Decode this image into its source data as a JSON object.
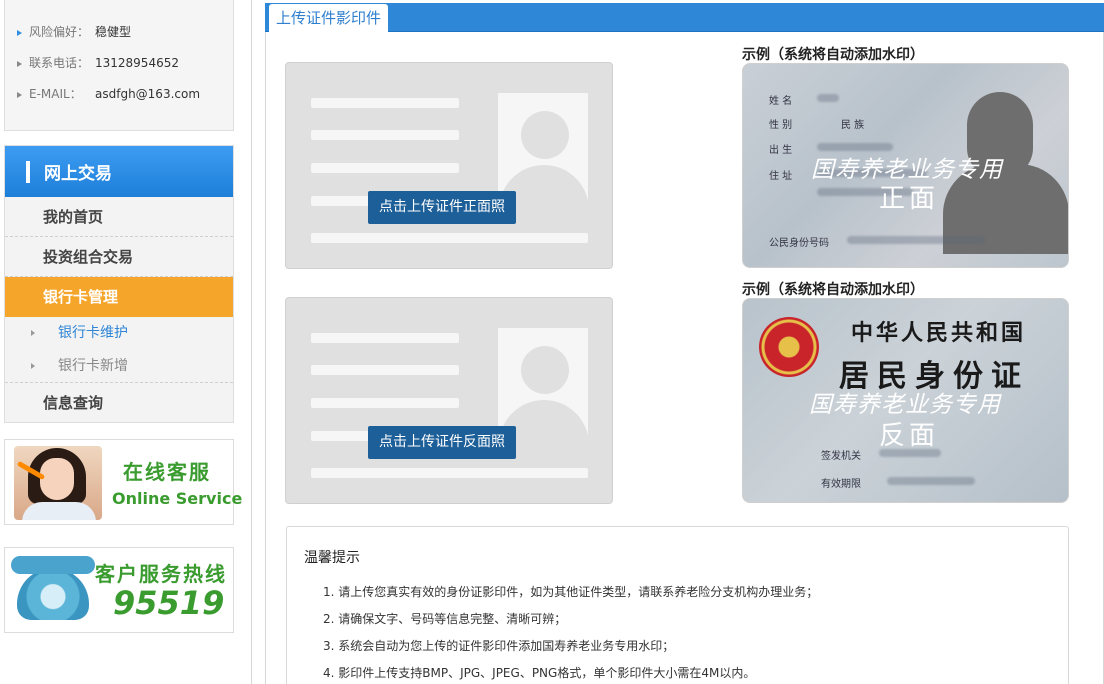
{
  "profile": {
    "items": [
      {
        "label": "风险偏好：",
        "value": "稳健型"
      },
      {
        "label": "联系电话：",
        "value": "13128954652"
      },
      {
        "label": "E-MAIL：",
        "value": "asdfgh@163.com"
      }
    ]
  },
  "menu": {
    "title": "网上交易",
    "items": [
      "我的首页",
      "投资组合交易",
      "银行卡管理"
    ],
    "active": "银行卡管理",
    "sub_items": [
      "银行卡维护",
      "银行卡新增"
    ],
    "last_item": "信息查询"
  },
  "banners": {
    "online_service": {
      "cn": "在线客服",
      "en": "Online Service"
    },
    "hotline": {
      "cn": "客户服务热线",
      "number": "95519"
    }
  },
  "main": {
    "tab": "上传证件影印件",
    "upload_front_button": "点击上传证件正面照",
    "upload_back_button": "点击上传证件反面照",
    "example_title": "示例（系统将自动添加水印）",
    "front_card": {
      "fields": [
        "姓 名",
        "性 别",
        "民 族",
        "出 生",
        "住 址",
        "公民身份号码"
      ],
      "watermark": "国寿养老业务专用",
      "side": "正面"
    },
    "back_card": {
      "country": "中华人民共和国",
      "doc": "居民身份证",
      "watermark": "国寿养老业务专用",
      "side": "反面",
      "fields": [
        "签发机关",
        "有效期限"
      ]
    },
    "tips": {
      "title": "温馨提示",
      "items": [
        "1.  请上传您真实有效的身份证影印件，如为其他证件类型，请联系养老险分支机构办理业务；",
        "2.  请确保文字、号码等信息完整、清晰可辨；",
        "3.  系统会自动为您上传的证件影印件添加国寿养老业务专用水印；",
        "4.  影印件上传支持BMP、JPG、JPEG、PNG格式，单个影印件大小需在4M以内。"
      ]
    }
  },
  "colors": {
    "accent_blue": "#2f87d7",
    "menu_active": "#f4a52a",
    "button_blue": "#1d5f98",
    "brand_green": "#3a9b2f"
  }
}
